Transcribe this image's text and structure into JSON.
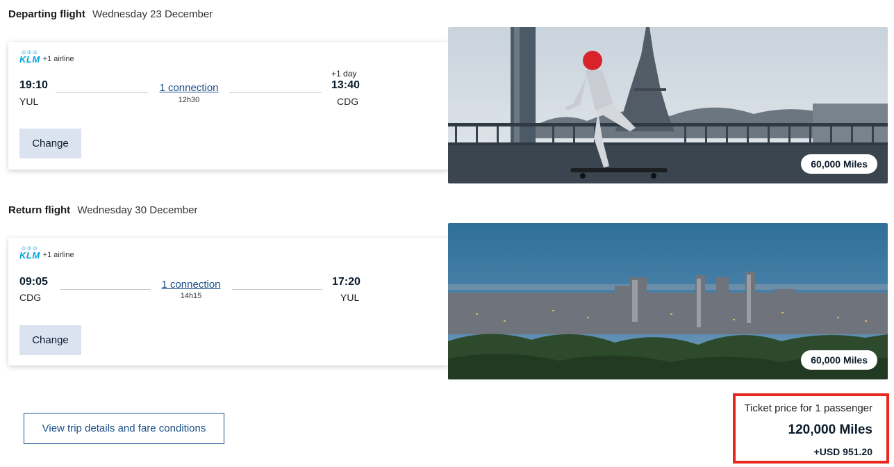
{
  "departing": {
    "heading": "Departing flight",
    "date": "Wednesday 23 December",
    "airline_logo": "KLM",
    "extra_airlines": "+1 airline",
    "depart_time": "19:10",
    "depart_code": "YUL",
    "connection": "1 connection",
    "duration": "12h30",
    "plus_day": "+1 day",
    "arrive_time": "13:40",
    "arrive_code": "CDG",
    "change_label": "Change",
    "miles": "60,000 Miles",
    "photo_desc_icon": "paris-photo"
  },
  "returning": {
    "heading": "Return flight",
    "date": "Wednesday 30 December",
    "airline_logo": "KLM",
    "extra_airlines": "+1 airline",
    "depart_time": "09:05",
    "depart_code": "CDG",
    "connection": "1 connection",
    "duration": "14h15",
    "arrive_time": "17:20",
    "arrive_code": "YUL",
    "change_label": "Change",
    "miles": "60,000 Miles",
    "photo_desc_icon": "montreal-photo"
  },
  "details_button": "View trip details and fare conditions",
  "price": {
    "label": "Ticket price for 1 passenger",
    "miles": "120,000 Miles",
    "cash": "+USD 951.20"
  },
  "colors": {
    "klm_blue": "#00a1de",
    "link_blue": "#1b4f8b",
    "button_bg": "#dbe3f1",
    "highlight_red": "#e8281e"
  }
}
